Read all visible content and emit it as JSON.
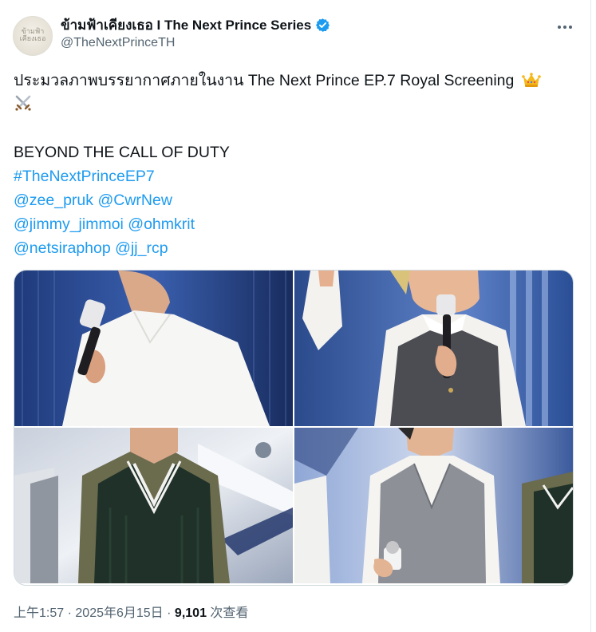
{
  "post": {
    "display_name": "ข้ามฟ้าเคียงเธอ I The Next Prince Series",
    "handle": "@TheNextPrinceTH",
    "avatar_text": "ข้ามฟ้า เคียงเธอ",
    "verified": true,
    "text_line1": "ประมวลภาพบรรยากาศภายในงาน The Next Prince EP.7 Royal Screening",
    "tagline": "BEYOND THE CALL OF DUTY",
    "hashtag": "#TheNextPrinceEP7",
    "mentions": [
      [
        "@zee_pruk",
        "@CwrNew"
      ],
      [
        "@jimmy_jimmoi",
        "@ohmkrit"
      ],
      [
        "@netsiraphop",
        "@jj_rcp"
      ]
    ],
    "emoji": [
      "crown-icon",
      "crossed-swords-icon"
    ],
    "time": "上午1:57",
    "date": "2025年6月15日",
    "views_count": "9,101",
    "views_label": "次查看",
    "separator": "·"
  },
  "colors": {
    "link": "#1d9bf0",
    "verified": "#1d9bf0",
    "secondary": "#536471"
  }
}
